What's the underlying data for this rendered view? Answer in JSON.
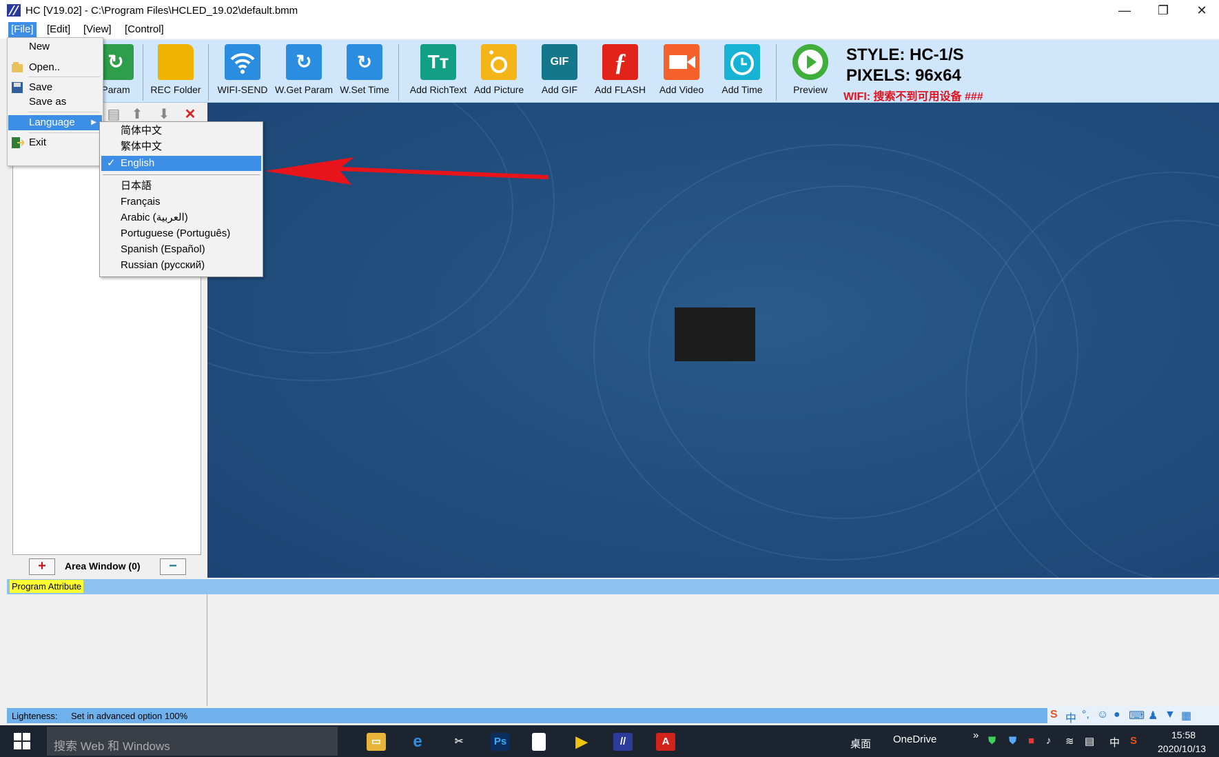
{
  "window": {
    "title": "HC [V19.02] - C:\\Program Files\\HCLED_19.02\\default.bmm",
    "minimize": "—",
    "restore": "❐",
    "close": "✕"
  },
  "menubar": [
    "[File]",
    "[Edit]",
    "[View]",
    "[Control]"
  ],
  "toolbar": {
    "buttons": [
      {
        "label": "Param",
        "icon": "refresh-icon",
        "color": "#2e9e4a"
      },
      {
        "label": "REC Folder",
        "icon": "folder-icon",
        "color": "#f0b400"
      },
      {
        "label": "WIFI-SEND",
        "icon": "wifi-icon",
        "color": "#2a8de0"
      },
      {
        "label": "W.Get Param",
        "icon": "refresh-icon",
        "color": "#2a8de0"
      },
      {
        "label": "W.Set Time",
        "icon": "timer-icon",
        "color": "#2a8de0"
      },
      {
        "label": "Add RichText",
        "icon": "richtext-icon",
        "color": "#139f86"
      },
      {
        "label": "Add Picture",
        "icon": "camera-icon",
        "color": "#f5b417"
      },
      {
        "label": "Add GIF",
        "icon": "gif-icon",
        "color": "#14778b"
      },
      {
        "label": "Add FLASH",
        "icon": "flash-icon",
        "color": "#e2231a"
      },
      {
        "label": "Add Video",
        "icon": "video-icon",
        "color": "#f4612b"
      },
      {
        "label": "Add Time",
        "icon": "clock-icon",
        "color": "#17b3d4"
      },
      {
        "label": "Preview",
        "icon": "play-icon",
        "color": "#3fae3a"
      }
    ],
    "gif_text": "GIF",
    "richtext_text": "Tт",
    "style": "STYLE: HC-1/S",
    "pixels": "PIXELS: 96x64",
    "wifi": "WIFI:  搜索不到可用设备 ###"
  },
  "left_panel": {
    "area_window": "Area Window (0)",
    "add_symbol": "+",
    "remove_symbol": "−"
  },
  "file_menu": {
    "new": "New",
    "open": "Open..",
    "save": "Save",
    "save_as": "Save as",
    "language": "Language",
    "exit": "Exit"
  },
  "language_menu": {
    "items": [
      {
        "label": "简体中文",
        "checked": false
      },
      {
        "label": "繁体中文",
        "checked": false
      },
      {
        "label": "English",
        "checked": true
      },
      {
        "label": "日本語",
        "checked": false
      },
      {
        "label": "Français",
        "checked": false
      },
      {
        "label": "Arabic (العربية)",
        "checked": false
      },
      {
        "label": "Portuguese (Português)",
        "checked": false
      },
      {
        "label": "Spanish (Español)",
        "checked": false
      },
      {
        "label": "Russian (русский)",
        "checked": false
      }
    ],
    "check_mark": "✓"
  },
  "program_attribute": "Program Attribute",
  "status": {
    "lighteness_label": "Lighteness:",
    "lighteness_value": "Set in advanced option  100%"
  },
  "taskbar": {
    "search_placeholder": "搜索 Web 和 Windows",
    "desktop": "桌面",
    "onedrive": "OneDrive",
    "ime_lang": "中",
    "time": "15:58",
    "date": "2020/10/13"
  }
}
